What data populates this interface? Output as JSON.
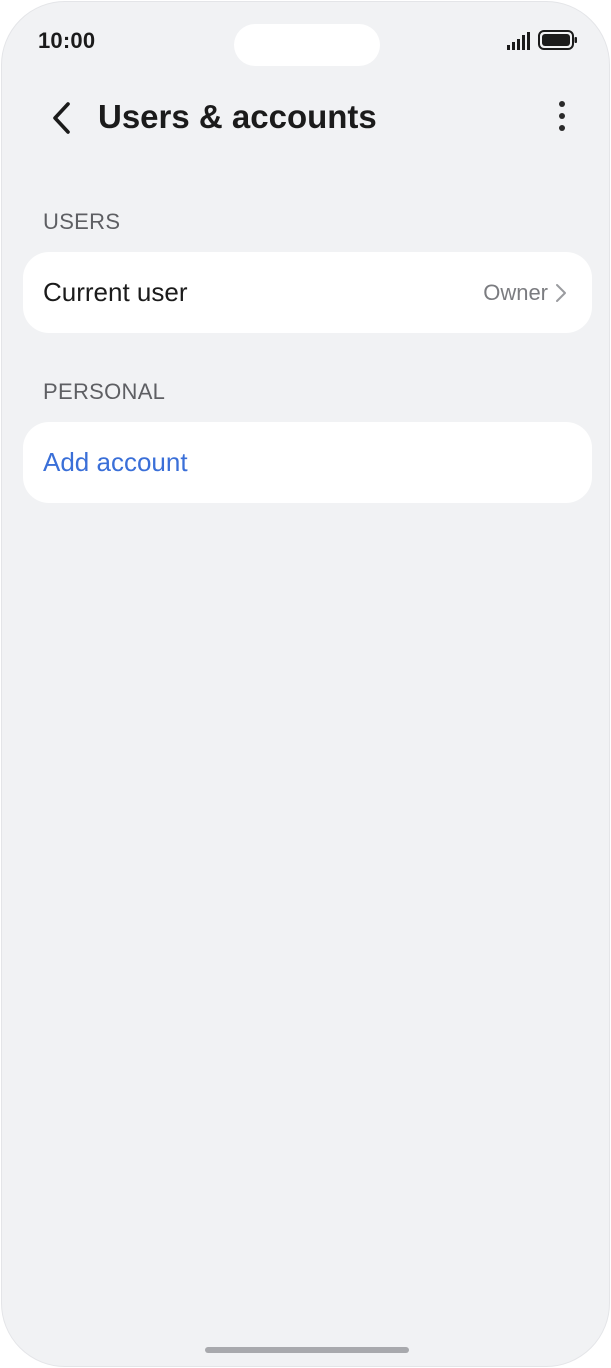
{
  "status_bar": {
    "time": "10:00"
  },
  "header": {
    "title": "Users & accounts",
    "back_icon": "chevron-left-icon",
    "more_icon": "more-vertical-icon"
  },
  "sections": {
    "users": {
      "label": "USERS",
      "current_user": {
        "title": "Current user",
        "value": "Owner"
      }
    },
    "personal": {
      "label": "PERSONAL",
      "add_account": {
        "title": "Add account"
      }
    }
  },
  "colors": {
    "background": "#f1f2f4",
    "card": "#ffffff",
    "link": "#3a6fd8"
  }
}
